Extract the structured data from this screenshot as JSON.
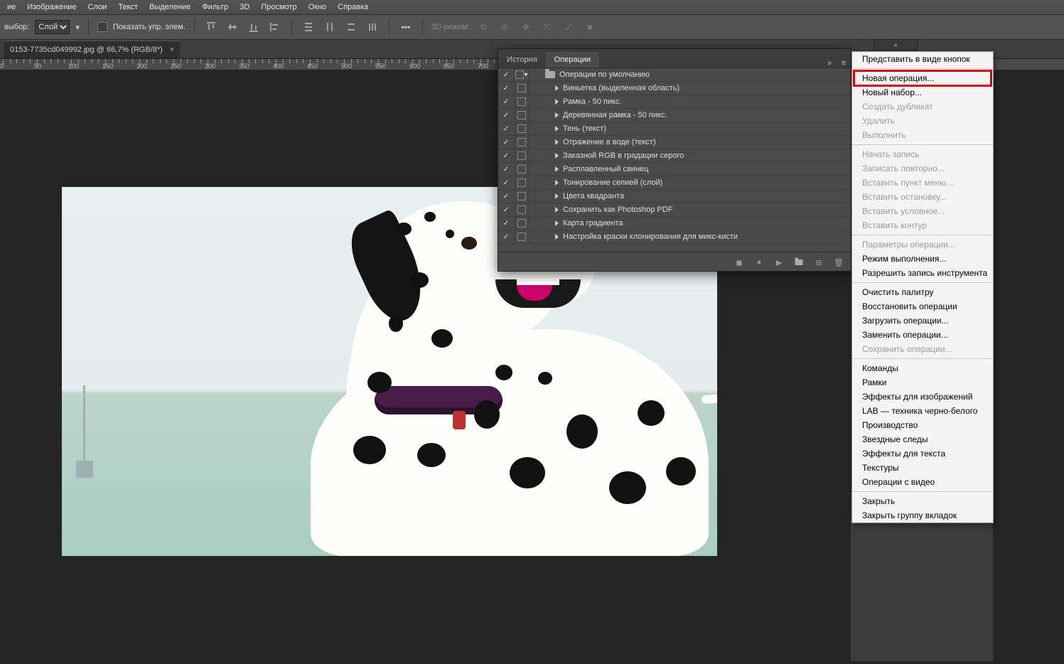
{
  "menu": {
    "items": [
      "ие",
      "Изображение",
      "Слои",
      "Текст",
      "Выделение",
      "Фильтр",
      "3D",
      "Просмотр",
      "Окно",
      "Справка"
    ]
  },
  "optionsBar": {
    "label_select": "выбор:",
    "select_value": "Слой",
    "show_ctrl": "Показать упр. элем.",
    "mode3d": "3D-режим:"
  },
  "docTab": {
    "title": "0153-7735cd049992.jpg @ 66,7% (RGB/8*)",
    "close": "×"
  },
  "ruler": {
    "start": 0,
    "step": 50,
    "count": 14
  },
  "panel": {
    "tabs": {
      "history": "История",
      "actions": "Операции"
    },
    "collapse": "»",
    "menu_icon": "≡",
    "folder": "Операции по умолчанию",
    "actions": [
      "Виньетка (выделенная область)",
      "Рамка - 50 пикс.",
      "Деревянная рамка - 50 пикс.",
      "Тень (текст)",
      "Отражение в воде (текст)",
      "Заказной RGB в градации серого",
      "Расплавленный свинец",
      "Тонирование сепией (слой)",
      "Цвета квадранта",
      "Сохранить как Photoshop PDF",
      "Карта градиента",
      "Настройка краски клонирования для микс-кисти"
    ]
  },
  "ctxMenu": {
    "groups": [
      [
        {
          "t": "Представить в виде кнопок",
          "d": false
        }
      ],
      [
        {
          "t": "Новая операция...",
          "d": false,
          "hl": true
        },
        {
          "t": "Новый набор...",
          "d": false
        },
        {
          "t": "Создать дубликат",
          "d": true
        },
        {
          "t": "Удалить",
          "d": true
        },
        {
          "t": "Выполнить",
          "d": true
        }
      ],
      [
        {
          "t": "Начать запись",
          "d": true
        },
        {
          "t": "Записать повторно...",
          "d": true
        },
        {
          "t": "Вставить пункт меню...",
          "d": true
        },
        {
          "t": "Вставить остановку...",
          "d": true
        },
        {
          "t": "Вставить условное...",
          "d": true
        },
        {
          "t": "Вставить контур",
          "d": true
        }
      ],
      [
        {
          "t": "Параметры операции...",
          "d": true
        },
        {
          "t": "Режим выполнения...",
          "d": false
        },
        {
          "t": "Разрешить запись инструмента",
          "d": false
        }
      ],
      [
        {
          "t": "Очистить палитру",
          "d": false
        },
        {
          "t": "Восстановить операции",
          "d": false
        },
        {
          "t": "Загрузить операции...",
          "d": false
        },
        {
          "t": "Заменить операции...",
          "d": false
        },
        {
          "t": "Сохранить операции...",
          "d": true
        }
      ],
      [
        {
          "t": "Команды",
          "d": false
        },
        {
          "t": "Рамки",
          "d": false
        },
        {
          "t": "Эффекты для изображений",
          "d": false
        },
        {
          "t": "LAB — техника черно-белого",
          "d": false
        },
        {
          "t": "Производство",
          "d": false
        },
        {
          "t": "Звездные следы",
          "d": false
        },
        {
          "t": "Эффекты для текста",
          "d": false
        },
        {
          "t": "Текстуры",
          "d": false
        },
        {
          "t": "Операции с видео",
          "d": false
        }
      ],
      [
        {
          "t": "Закрыть",
          "d": false
        },
        {
          "t": "Закрыть группу вкладок",
          "d": false
        }
      ]
    ]
  },
  "rp_top": "«"
}
